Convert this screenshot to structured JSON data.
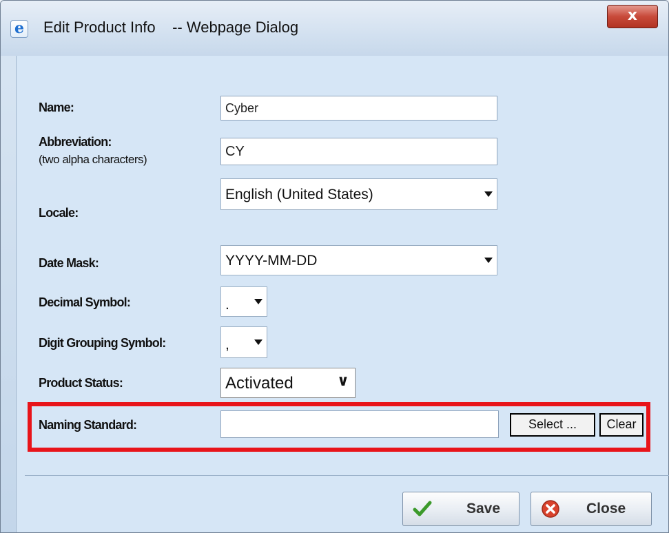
{
  "window": {
    "title": "Edit Product Info    -- Webpage Dialog",
    "title_icon": "internet-explorer-icon",
    "close_glyph": "x"
  },
  "form": {
    "name": {
      "label": "Name:",
      "value": "Cyber"
    },
    "abbreviation": {
      "label": "Abbreviation:",
      "hint": "(two alpha characters)",
      "value": "CY"
    },
    "locale": {
      "label": "Locale:",
      "value": "English (United States)"
    },
    "date_mask": {
      "label": "Date Mask:",
      "value": "YYYY-MM-DD"
    },
    "decimal_symbol": {
      "label": "Decimal Symbol:",
      "value": "."
    },
    "digit_grouping": {
      "label": "Digit Grouping Symbol:",
      "value": ","
    },
    "product_status": {
      "label": "Product Status:",
      "value": "Activated"
    },
    "naming_standard": {
      "label": "Naming Standard:",
      "value": "",
      "select_label": "Select ...",
      "clear_label": "Clear"
    }
  },
  "footer": {
    "save_label": "Save",
    "close_label": "Close"
  },
  "colors": {
    "highlight_border": "#e8141a",
    "background": "#d6e6f6"
  }
}
